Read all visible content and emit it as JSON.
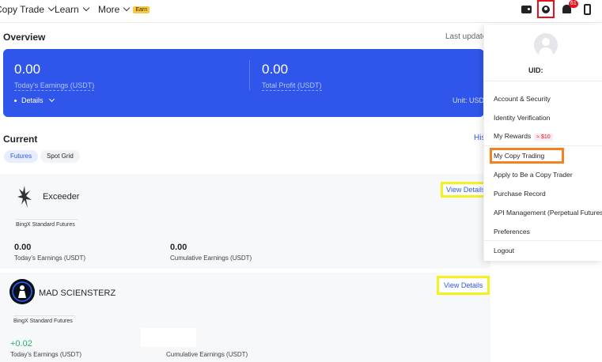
{
  "nav": {
    "copy_trade": "Copy Trade",
    "learn": "Learn",
    "more": "More",
    "earn_badge": "Earn",
    "notification_count": "61"
  },
  "overview": {
    "title": "Overview",
    "last_updated": "Last updated",
    "todays_earnings_value": "0.00",
    "todays_earnings_label": "Today's Earnings (USDT)",
    "total_profit_value": "0.00",
    "total_profit_label": "Total Profit (USDT)",
    "details": "Details",
    "unit": "Unit: USDT"
  },
  "current": {
    "title": "Current",
    "history": "History",
    "tabs": [
      "Futures",
      "Spot Grid"
    ]
  },
  "traders": [
    {
      "name": "Exceeder",
      "tag": "BingX Standard Futures",
      "todays_earnings_value": "0.00",
      "todays_earnings_label": "Today's Earnings (USDT)",
      "cumulative_value": "0.00",
      "cumulative_label": "Cumulative Earnings (USDT)",
      "view_details": "View Details"
    },
    {
      "name": "MAD SCIENSTERZ",
      "tag": "BingX Standard Futures",
      "todays_earnings_value": "+0.02",
      "todays_earnings_label": "Today's Earnings (USDT)",
      "cumulative_value": "",
      "cumulative_label": "Cumulative Earnings (USDT)",
      "view_details": "View Details"
    }
  ],
  "account_menu": {
    "uid_label": "UID:",
    "items": [
      "Account & Security",
      "Identity Verification",
      "My Rewards",
      "My Copy Trading",
      "Apply to Be a Copy Trader",
      "Purchase Record",
      "API Management (Perpetual Futures)",
      "Preferences",
      "Logout"
    ],
    "rewards_badge": "≈ $10"
  },
  "colors": {
    "brand_blue": "#2f55ea",
    "gain_green": "#20b26c",
    "alert_red": "#e4121b",
    "highlight_yellow": "#f6f01c",
    "highlight_orange": "#f5821f"
  }
}
